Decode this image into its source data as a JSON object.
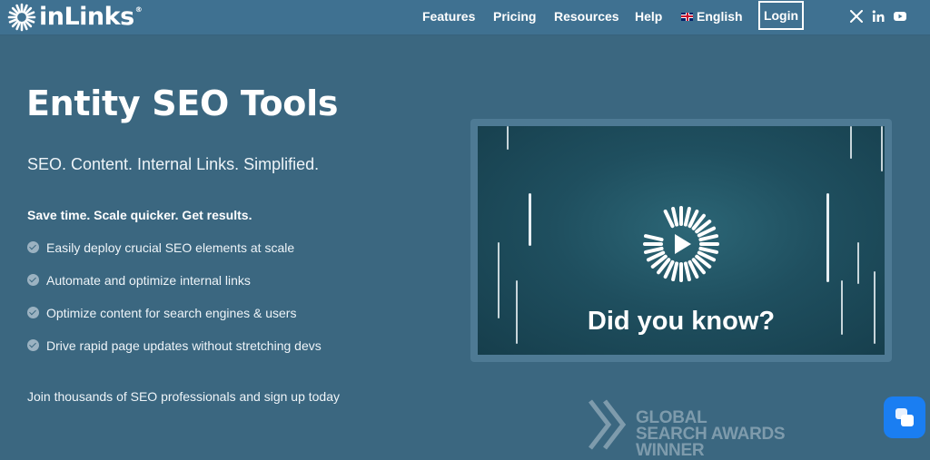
{
  "brand": {
    "name": "inLinks",
    "registered_mark": "®"
  },
  "nav": {
    "links": [
      "Features",
      "Pricing",
      "Resources",
      "Help"
    ],
    "language": "English",
    "login_label": "Login",
    "social_icons": [
      "x-icon",
      "linkedin-icon",
      "youtube-icon"
    ]
  },
  "hero": {
    "title": "Entity SEO Tools",
    "subtitle": "SEO. Content. Internal Links. Simplified.",
    "lead": "Save time. Scale quicker. Get results.",
    "features": [
      "Easily deploy crucial SEO elements at scale",
      "Automate and optimize internal links",
      "Optimize content for search engines & users",
      "Drive rapid page updates without stretching devs"
    ],
    "join_text": "Join thousands of SEO professionals and sign up today"
  },
  "video": {
    "caption": "Did you know?"
  },
  "award": {
    "line1": "GLOBAL",
    "line2": "SEARCH AWARDS",
    "line3": "WINNER"
  },
  "colors": {
    "page_bg": "#3b6780",
    "nav_bg": "#3f7191",
    "video_bg": "#1f4f5f",
    "chat_button": "#1a7ef2"
  }
}
